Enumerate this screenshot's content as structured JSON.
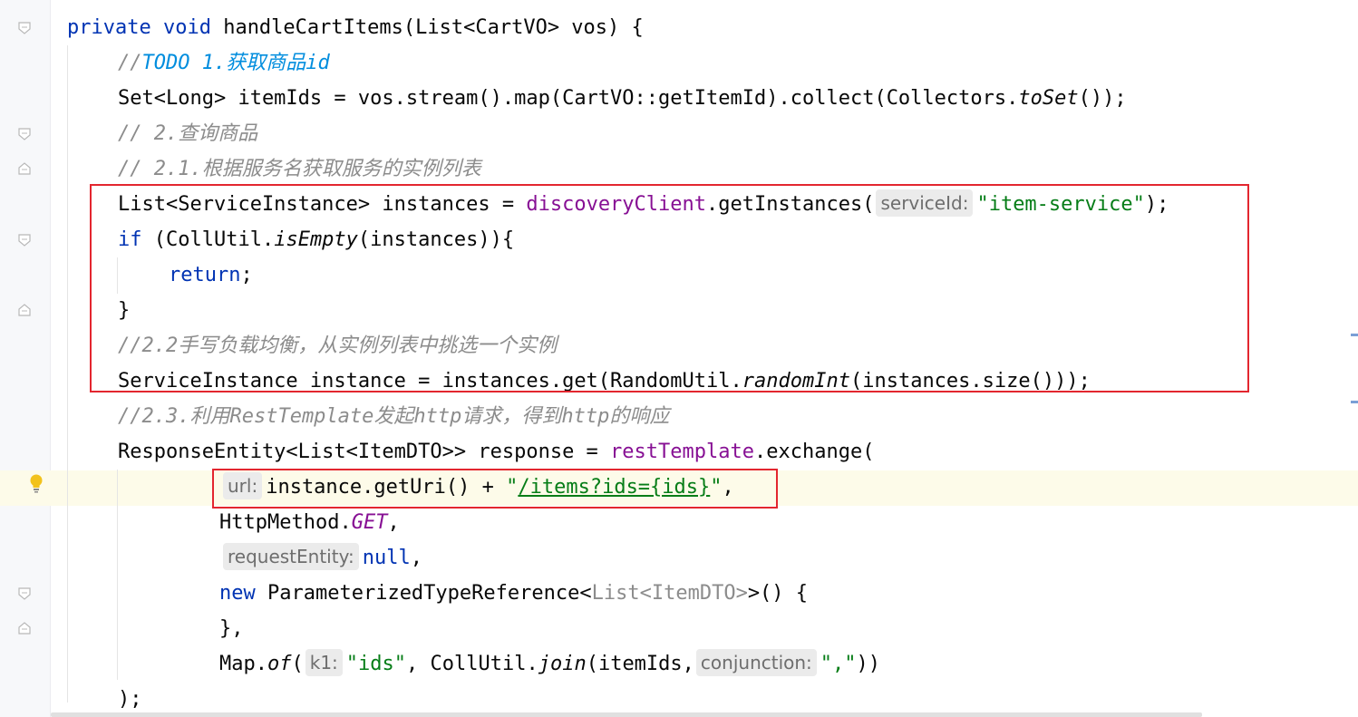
{
  "editor": {
    "lines": {
      "l1": {
        "kw1": "private",
        "kw2": "void",
        "rest": " handleCartItems(List<CartVO> vos) {"
      },
      "l2": {
        "prefix": "//",
        "todo": "TODO 1.获取商品id"
      },
      "l3": {
        "a": "Set<Long> itemIds = vos.stream().map(CartVO::getItemId).collect(Collectors.",
        "b": "toSet",
        "c": "());"
      },
      "l4": {
        "comment": "// 2.查询商品"
      },
      "l5": {
        "comment": "// 2.1.根据服务名获取服务的实例列表"
      },
      "l6": {
        "a": "List<ServiceInstance> instances = ",
        "field": "discoveryClient",
        "b": ".getInstances(",
        "hint": "serviceId:",
        "str": "\"item-service\"",
        "c": ");"
      },
      "l7": {
        "kw": "if",
        "a": " (CollUtil.",
        "b": "isEmpty",
        "c": "(instances)){"
      },
      "l8": {
        "kw": "return",
        "a": ";"
      },
      "l9": {
        "a": "}"
      },
      "l10": {
        "comment": "//2.2手写负载均衡，从实例列表中挑选一个实例"
      },
      "l11": {
        "a": "ServiceInstance instance = instances.get(RandomUtil.",
        "b": "randomInt",
        "c": "(instances.size()));"
      },
      "l12": {
        "comment": "//2.3.利用RestTemplate发起http请求，得到http的响应"
      },
      "l13": {
        "a": "ResponseEntity<List<ItemDTO>> response = ",
        "field": "restTemplate",
        "b": ".exchange("
      },
      "l14": {
        "hint": "url:",
        "a": "instance.getUri() + ",
        "q1": "\"",
        "link": "/items?ids={ids}",
        "q2": "\"",
        "b": ","
      },
      "l15": {
        "a": "HttpMethod.",
        "b": "GET",
        "c": ","
      },
      "l16": {
        "hint": "requestEntity:",
        "kw": "null",
        "a": ","
      },
      "l17": {
        "kw": "new",
        "a": " ParameterizedTypeReference<",
        "gen": "List<ItemDTO>",
        "b": ">() {"
      },
      "l18": {
        "a": "},"
      },
      "l19": {
        "a": "Map.",
        "b": "of",
        "c": "(",
        "hint1": "k1:",
        "str1": "\"ids\"",
        "d": ", CollUtil.",
        "e": "join",
        "f": "(itemIds,",
        "hint2": "conjunction:",
        "str2": "\",\"",
        "g": "))"
      },
      "l20": {
        "a": ");"
      }
    }
  },
  "colors": {
    "keyword": "#0033b3",
    "comment": "#8c8c8c",
    "todo": "#008dde",
    "field": "#871094",
    "string": "#067d17",
    "highlight_box": "#e3262f"
  },
  "icons": [
    "fold-marker-icon",
    "intention-bulb-icon"
  ]
}
